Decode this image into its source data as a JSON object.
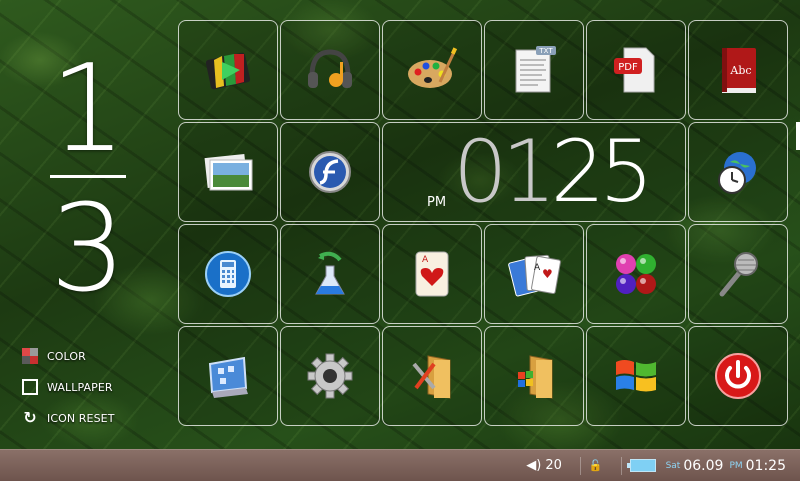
{
  "page_indicator": {
    "current": "1",
    "total": "3"
  },
  "left_menu": [
    {
      "label": "COLOR",
      "icon": "color-icon"
    },
    {
      "label": "WALLPAPER",
      "icon": "wallpaper-icon"
    },
    {
      "label": "ICON RESET",
      "icon": "reset-icon"
    }
  ],
  "apps": [
    "video-player-icon",
    "music-headphones-icon",
    "paint-palette-icon",
    "text-document-icon",
    "pdf-document-icon",
    "dictionary-book-icon",
    "photo-viewer-icon",
    "flash-player-icon",
    "world-clock-icon",
    "calculator-icon",
    "science-flask-icon",
    "ace-of-hearts-card-icon",
    "solitaire-cards-icon",
    "color-balls-game-icon",
    "microphone-icon",
    "control-panel-icon",
    "settings-gear-icon",
    "tools-folder-icon",
    "windows-folder-icon",
    "windows-logo-icon",
    "power-button-icon"
  ],
  "clock": {
    "ampm": "PM",
    "hours": "01",
    "minutes": "25"
  },
  "status_bar": {
    "volume_icon": "speaker-icon",
    "volume_level": "20",
    "lock_icon": "lock-icon",
    "battery_icon": "battery-icon",
    "day": "Sat",
    "date": "06.09",
    "ampm": "PM",
    "time": "01:25",
    "accent_color": "#8ed4f4"
  },
  "colors": {
    "status_bar_bg": "#7a6059",
    "tile_border": "#ffffff"
  }
}
